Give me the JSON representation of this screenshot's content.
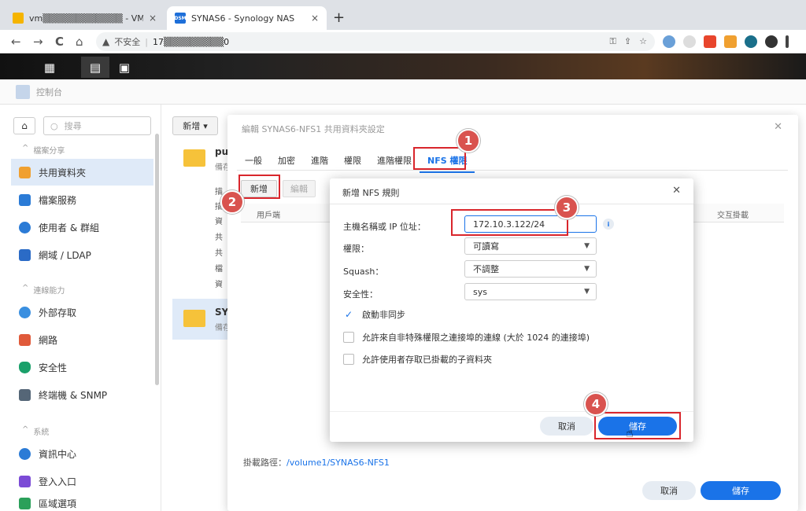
{
  "browser": {
    "tabs": [
      {
        "title": "vm▒▒▒▒▒▒▒▒▒▒▒▒ - VM",
        "close": "×"
      },
      {
        "title": "SYNAS6 - Synology NAS",
        "favicon": "DSM",
        "close": "×"
      }
    ],
    "new_tab": "+",
    "nav": {
      "back": "←",
      "forward": "→",
      "reload": "C",
      "home": "⌂"
    },
    "omnibox": {
      "insecure_icon": "▲",
      "insecure_label": "不安全",
      "separator": "|",
      "url": "17▒▒▒▒▒▒▒▒▒0"
    },
    "omni_right": [
      "⚿",
      "⇪",
      "☆"
    ]
  },
  "control_panel": {
    "title": "控制台",
    "search_placeholder": "搜尋",
    "sections": [
      {
        "label": "檔案分享",
        "chevron": "^"
      },
      {
        "label": "連線能力",
        "chevron": "^"
      },
      {
        "label": "系統",
        "chevron": "^"
      }
    ],
    "nav": [
      {
        "label": "共用資料夾",
        "color": "#f0a030"
      },
      {
        "label": "檔案服務",
        "color": "#2b7bd6"
      },
      {
        "label": "使用者 & 群組",
        "color": "#2b7bd6"
      },
      {
        "label": "網域 / LDAP",
        "color": "#2b6bc6"
      },
      {
        "label": "外部存取",
        "color": "#3a8fe0"
      },
      {
        "label": "網路",
        "color": "#e05a3a"
      },
      {
        "label": "安全性",
        "color": "#1aa06a"
      },
      {
        "label": "終端機 & SNMP",
        "color": "#556677"
      },
      {
        "label": "資訊中心",
        "color": "#2b7bd6"
      },
      {
        "label": "登入入口",
        "color": "#7b4bd6"
      },
      {
        "label": "區域選項",
        "color": "#2ba05a"
      }
    ],
    "add_button": "新增",
    "add_caret": "▾",
    "folders": [
      {
        "name": "pu",
        "sub": "備存"
      },
      {
        "name": "SY",
        "sub": "備存"
      }
    ],
    "meta_labels": [
      "描",
      "描",
      "資",
      "共",
      "共",
      "檔",
      "資"
    ]
  },
  "edit_dialog": {
    "title": "編輯 SYNAS6-NFS1 共用資料夾設定",
    "close": "✕",
    "tabs": [
      "一般",
      "加密",
      "進階",
      "權限",
      "進階權限",
      "NFS 權限"
    ],
    "active_tab": "NFS 權限",
    "add_button": "新增",
    "edit_button": "編輯",
    "columns": [
      "用戶端",
      "交互掛載"
    ],
    "mount_path_label": "掛載路徑：",
    "mount_path": "/volume1/SYNAS6-NFS1",
    "cancel": "取消",
    "save": "儲存"
  },
  "nfs_dialog": {
    "title": "新增 NFS 規則",
    "close": "✕",
    "fields": [
      {
        "label": "主機名稱或 IP 位址：",
        "value": "172.10.3.122/24"
      },
      {
        "label": "權限：",
        "value": "可讀寫"
      },
      {
        "label": "Squash：",
        "value": "不調整"
      },
      {
        "label": "安全性：",
        "value": "sys"
      }
    ],
    "info_icon": "i",
    "caret": "▼",
    "checkboxes": [
      {
        "label": "啟動非同步",
        "checked": true,
        "mark": "✓"
      },
      {
        "label": "允許來自非特殊權限之連接埠的連線 (大於 1024 的連接埠)",
        "checked": false,
        "mark": ""
      },
      {
        "label": "允許使用者存取已掛載的子資料夾",
        "checked": false,
        "mark": ""
      }
    ],
    "cancel": "取消",
    "save": "儲存"
  },
  "callouts": [
    "1",
    "2",
    "3",
    "4"
  ],
  "colors": {
    "accent": "#1a73e8",
    "callout": "#d9534f",
    "highlight": "#d9262c"
  }
}
